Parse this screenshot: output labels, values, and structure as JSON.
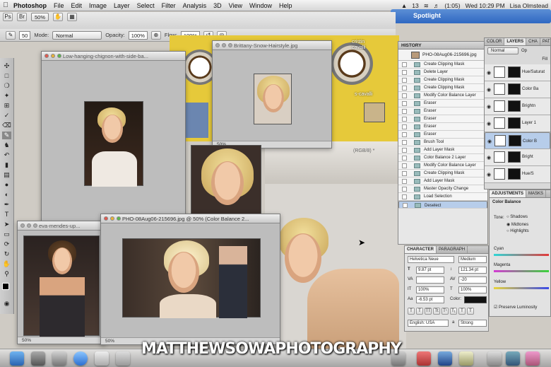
{
  "menubar": {
    "items": [
      "Photoshop",
      "File",
      "Edit",
      "Image",
      "Layer",
      "Select",
      "Filter",
      "Analysis",
      "3D",
      "View",
      "Window",
      "Help"
    ],
    "status": {
      "count": "13",
      "battery": "(1:05)",
      "clock": "Wed 10:29 PM",
      "user": "Lisa Olmstead"
    }
  },
  "spotlight": {
    "label": "Spotlight"
  },
  "options": {
    "size": "50",
    "mode_label": "Mode:",
    "mode_value": "Normal",
    "opacity_label": "Opacity:",
    "opacity_value": "100%",
    "flow_label": "Flow:",
    "flow_value": "100%",
    "zoom": "50%"
  },
  "documents": [
    {
      "title": "Low-hanging-chignon-with-side-ba..."
    },
    {
      "title": "Brittany-Snow-Hairstyle.jpg"
    },
    {
      "title": "eva-mendes-up..."
    },
    {
      "title": "PHO-08Aug06-215696.jpg @ 50% (Color Balance 2..."
    },
    {
      "title": "(RGB/8) *"
    }
  ],
  "doc_status": {
    "zoom1": "50%",
    "zoom2": "50%",
    "zoom3": "50%"
  },
  "minion_text": {
    "line1": "cristin",
    "line2": "cavalli",
    "line3": "s-cavalli"
  },
  "history": {
    "tab": "HISTORY",
    "snapshot": "PHO-08Aug06-215696.jpg",
    "items": [
      "Create Clipping Mask",
      "Delete Layer",
      "Create Clipping Mask",
      "Create Clipping Mask",
      "Modify Color Balance Layer",
      "Eraser",
      "Eraser",
      "Eraser",
      "Eraser",
      "Eraser",
      "Brush Tool",
      "Add Layer Mask",
      "Color Balance 2 Layer",
      "Modify Color Balance Layer",
      "Create Clipping Mask",
      "Add Layer Mask",
      "Master Opacity Change",
      "Load Selection",
      "Deselect"
    ],
    "selected_index": 18
  },
  "layers": {
    "tabs": [
      "COLOR",
      "LAYERS",
      "CHA",
      "PAT"
    ],
    "blend": "Normal",
    "opacity_label": "Op",
    "fill_label": "Fill",
    "rows": [
      {
        "name": "Hue/Saturat"
      },
      {
        "name": "Color Ba"
      },
      {
        "name": "Brightn"
      },
      {
        "name": "Layer 1"
      },
      {
        "name": "Color B"
      },
      {
        "name": "Bright"
      },
      {
        "name": "Hue/S"
      }
    ],
    "selected_index": 4
  },
  "adjustments": {
    "tabs": [
      "ADJUSTMENTS",
      "MASKS"
    ],
    "title": "Color Balance",
    "tone_label": "Tone:",
    "tones": [
      "Shadows",
      "Midtones",
      "Highlights"
    ],
    "selected_tone": "Midtones",
    "sliders": [
      {
        "label": "Cyan"
      },
      {
        "label": "Magenta"
      },
      {
        "label": "Yellow"
      }
    ],
    "preserve": "Preserve Luminosity"
  },
  "character": {
    "tabs": [
      "CHARACTER",
      "PARAGRAPH"
    ],
    "font": "Helvetica Neue",
    "style": "Medium",
    "size": "9.87 pt",
    "leading": "121.34 pt",
    "tracking": "-20",
    "vscale": "100%",
    "hscale": "100%",
    "baseline": "-6.53 pt",
    "color_label": "Color:",
    "language": "English: USA",
    "aa_label": "a",
    "aa_value": "Strong"
  },
  "watermark": {
    "text": "MATTHEWSOWAPHOTOGRAPHY"
  },
  "colors": {
    "accent": "#3a74c9",
    "selection": "#b7cdea",
    "minion": "#e6c93a"
  }
}
